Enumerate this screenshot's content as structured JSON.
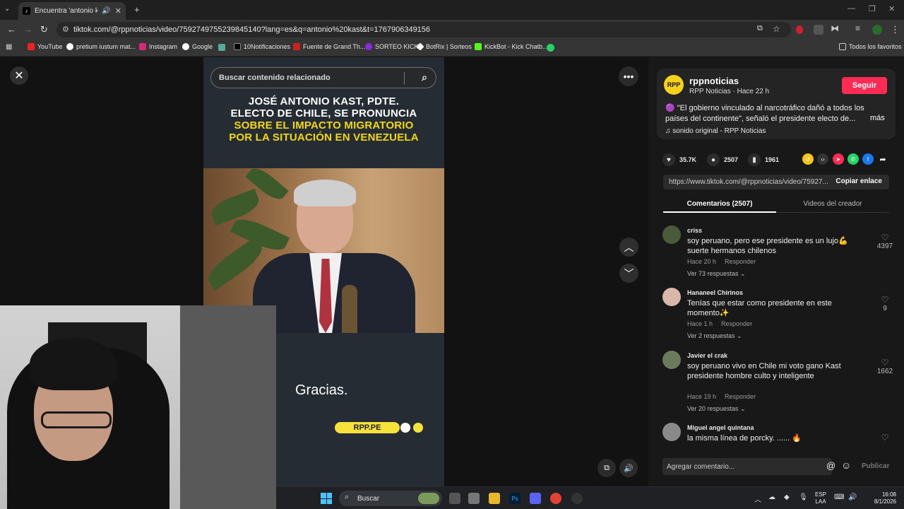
{
  "browser": {
    "tab_title": "Encuentra 'antonio kast' en",
    "url": "tiktok.com/@rppnoticias/video/7592749755239845140?lang=es&q=antonio%20kast&t=1767906349156",
    "bookmarks": [
      "YouTube",
      "pretium iustum mat...",
      "Instagram",
      "Google",
      "10Notificaciones",
      "Fuente de Grand Th...",
      "SORTEO KICK",
      "BotRix | Sorteos",
      "KickBot - Kick Chatb..."
    ],
    "all_bookmarks": "Todos los favoritos"
  },
  "video": {
    "search_placeholder": "Buscar contenido relacionado",
    "headline_white_1": "JOSÉ ANTONIO KAST, PDTE.",
    "headline_white_2": "ELECTO DE CHILE, SE PRONUNCIA",
    "headline_yellow_1": "SOBRE EL IMPACTO MIGRATORIO",
    "headline_yellow_2": "POR LA SITUACIÓN EN VENEZUELA",
    "caption": "Gracias.",
    "brand": "RPP.PE"
  },
  "author": {
    "avatar_text": "RPP",
    "name": "rppnoticias",
    "sub": "RPP Noticias · Hace 22 h",
    "follow_label": "Seguir",
    "description": "🟣 \"El gobierno vinculado al narcotráfico dañó a todos los países del continente\", señaló el presidente electo de...",
    "more": "más",
    "music": "♫  sonido original - RPP Noticias"
  },
  "stats": {
    "likes": "35.7K",
    "comments": "2507",
    "saves": "1961"
  },
  "link": {
    "url": "https://www.tiktok.com/@rppnoticias/video/75927...",
    "copy_label": "Copiar enlace"
  },
  "tabs": {
    "comments": "Comentarios (2507)",
    "creator_videos": "Videos del creador"
  },
  "comments": [
    {
      "name": "criss",
      "text": "soy peruano, pero ese presidente es un lujo💪 suerte hermanos chilenos",
      "time": "Hace 20 h",
      "reply": "Responder",
      "more": "Ver 73 respuestas ⌄",
      "likes": "4397",
      "color": "#4a5a3a"
    },
    {
      "name": "Hananeel Chirinos",
      "text": "Tenías que estar como presidente en este momento✨",
      "time": "Hace 1 h",
      "reply": "Responder",
      "more": "Ver 2 respuestas ⌄",
      "likes": "9",
      "color": "#d8b8a8"
    },
    {
      "name": "Javier el crak",
      "text": "soy peruano vivo en Chile mi voto gano Kast presidente hombre culto y inteligente",
      "time": "Hace 19 h",
      "reply": "Responder",
      "more": "Ver 20 respuestas ⌄",
      "likes": "1662",
      "color": "#6a7a5a"
    },
    {
      "name": "Miguel angel quintana",
      "text": "la misma línea de porcky. ...... 🔥",
      "time": "",
      "reply": "",
      "more": "",
      "likes": "",
      "color": "#8a8a8a"
    }
  ],
  "composer": {
    "placeholder": "Agregar comentario...",
    "publish": "Publicar"
  },
  "taskbar": {
    "search": "Buscar",
    "lang_1": "ESP",
    "lang_2": "LAA",
    "time": "16:08",
    "date": "8/1/2026"
  }
}
